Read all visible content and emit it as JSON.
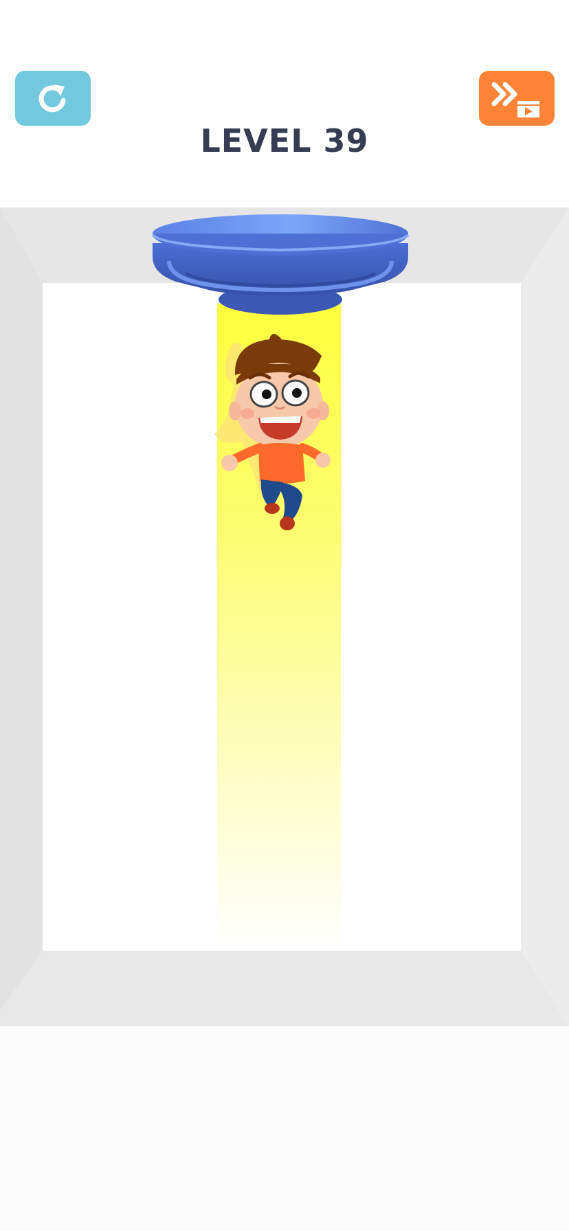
{
  "game": {
    "level_label": "LEVEL 39"
  },
  "buttons": {
    "restart_icon": "restart-icon",
    "skip_icon": "skip-video-icon"
  },
  "colors": {
    "restart_button": "#72c8dc",
    "skip_button": "#ff8438",
    "title_text": "#363d52",
    "ufo_body": "#5a7fe0",
    "light_beam": "#ffff40",
    "room_frame": "#e4e4e4"
  },
  "scene": {
    "character": "cartoon-boy",
    "object": "ceiling-light-beam-emitter"
  }
}
